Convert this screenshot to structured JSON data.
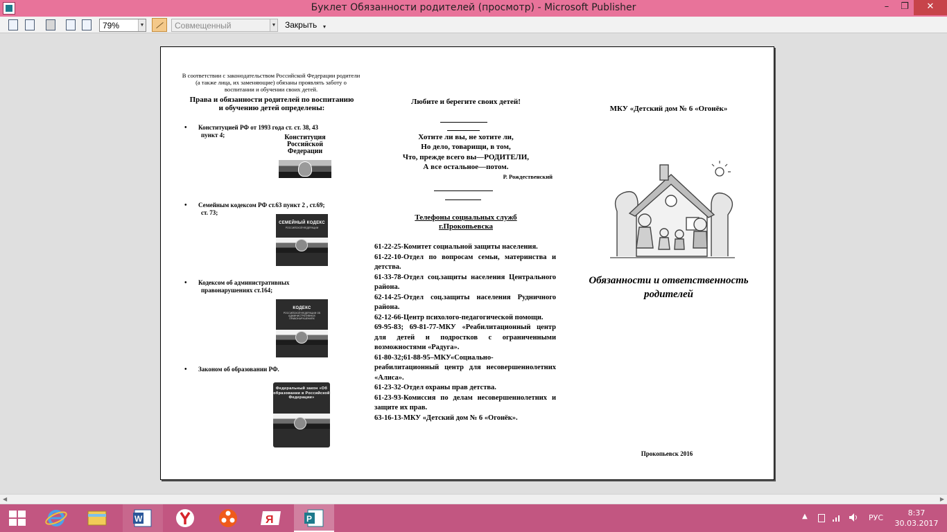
{
  "window": {
    "title": "Буклет Обязанности родителей (просмотр)  - Microsoft Publisher",
    "minimize_glyph": "–",
    "restore_glyph": "❐",
    "close_glyph": "✕"
  },
  "toolbar": {
    "zoom_value": "79%",
    "view_mode": "Совмещенный",
    "close_label": "Закрыть",
    "more_glyph": "▾",
    "dropdown_glyph": "▼",
    "icons": [
      "prev-page-icon",
      "next-page-icon",
      "print-icon",
      "single-page-icon",
      "multi-page-icon",
      "zoom-dropdown-icon",
      "pair-view-icon"
    ]
  },
  "booklet": {
    "col1": {
      "intro": "В соответствии с законодательством Российской Федерации родители (а также лица, их заменяющие) обязаны проявлять заботу о воспитании и обучении своих детей.",
      "heading": "Права и обязанности родителей по воспитанию и обучению детей определены:",
      "items": [
        {
          "line1": "Конституцией РФ от 1993 года ст. ст. 38, 43",
          "line2": "пункт 4;"
        },
        {
          "line1": "Семейным кодексом РФ ст.63 пункт 2 , ст.69;",
          "line2": "ст. 73;"
        },
        {
          "line1": "Кодексом об административных",
          "line2": "правонарушениях ст.164;"
        },
        {
          "line1": "Законом об образовании РФ.",
          "line2": ""
        }
      ],
      "books": {
        "constitution": "Конституция Российской Федерации",
        "family_code_title": "СЕМЕЙНЫЙ КОДЕКС",
        "family_code_sub": "РОССИЙСКОЙ ФЕДЕРАЦИИ",
        "admin_code_title": "КОДЕКС",
        "admin_code_sub": "РОССИЙСКОЙ ФЕДЕРАЦИИ ОБ АДМИНИСТРАТИВНЫХ ПРАВОНАРУШЕНИЯХ",
        "education_law": "Федеральный закон «Об образовании в Российской Федерации»"
      }
    },
    "col2": {
      "motto": "Любите и берегите своих детей!",
      "poem": [
        "Хотите ли вы, не хотите ли,",
        "Но дело, товарищи, в том,",
        "Что, прежде всего вы—РОДИТЕЛИ,",
        "А все остальное—потом."
      ],
      "poem_author": "Р. Рождественский",
      "phones_title_1": "Телефоны социальных служб",
      "phones_title_2": "г.Прокопьевска",
      "phones": [
        "61-22-25-Комитет социальной защиты населения.",
        "61-22-10-Отдел по вопросам семьи, материнства и детства.",
        "61-33-78-Отдел соц.защиты населения Центрального района.",
        "62-14-25-Отдел соц.защиты населения Рудничного района.",
        "62-12-66-Центр психолого-педагогической помощи.",
        "69-95-83; 69-81-77-МКУ «Реабилитационный центр для детей и подростков с ограниченными возможностями «Радуга».",
        "61-80-32;61-88-95–МКУ«Социально-реабилитационный центр для несовершеннолетних «Алиса».",
        "61-23-32-Отдел охраны прав детства.",
        "61-23-93-Комиссия по делам несовершеннолетних и защите их прав.",
        "63-16-13-МКУ «Детский дом № 6 «Огонёк»."
      ]
    },
    "col3": {
      "organization": "МКУ «Детский дом № 6 «Огонёк»",
      "title_1": "Обязанности и ответственность",
      "title_2": "родителей",
      "footer": "Прокопьевск 2016"
    }
  },
  "taskbar": {
    "apps": [
      "internet-explorer-icon",
      "file-explorer-icon",
      "word-icon",
      "yandex-icon",
      "media-player-icon",
      "yandex-browser-icon",
      "publisher-icon"
    ],
    "language": "РУС",
    "time": "8:37",
    "date": "30.03.2017"
  },
  "colors": {
    "titlebar": "#e8739a",
    "taskbar": "#c25681",
    "close_button": "#c7444a"
  }
}
